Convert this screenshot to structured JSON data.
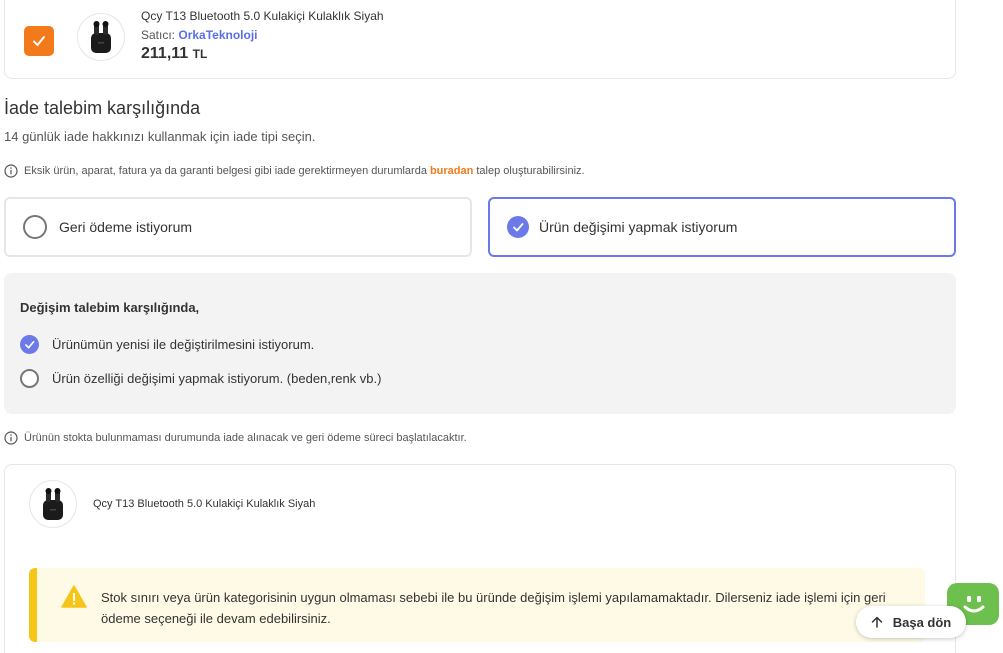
{
  "top_product": {
    "title": "Qcy T13 Bluetooth 5.0 Kulakiçi Kulaklık Siyah",
    "seller_label": "Satıcı:",
    "seller_name": "OrkaTeknoloji",
    "price": "211,11",
    "currency": "TL",
    "selected": true
  },
  "section": {
    "title": "İade talebim karşılığında",
    "subtitle": "14 günlük iade hakkınızı kullanmak için iade tipi seçin."
  },
  "info_note": {
    "before": "Eksik ürün, aparat, fatura ya da garanti belgesi gibi iade gerektirmeyen durumlarda",
    "link": "buradan",
    "after": "talep oluşturabilirsiniz."
  },
  "options": {
    "refund_label": "Geri ödeme istiyorum",
    "exchange_label": "Ürün değişimi yapmak istiyorum",
    "selected": "exchange"
  },
  "exchange_panel": {
    "title": "Değişim talebim karşılığında,",
    "option_new": "Ürünümün yenisi ile değiştirilmesini istiyorum.",
    "option_attr": "Ürün özelliği değişimi yapmak istiyorum. (beden,renk vb.)",
    "selected": "new"
  },
  "stock_note": "Ürünün stokta bulunmaması durumunda iade alınacak ve geri ödeme süreci başlatılacaktır.",
  "bottom_product": {
    "title": "Qcy T13 Bluetooth 5.0 Kulakiçi Kulaklık Siyah"
  },
  "warning": {
    "text": "Stok sınırı veya ürün kategorisinin uygun olmaması sebebi ile bu üründe değişim işlemi yapılamamaktadır. Dilerseniz iade işlemi için geri ödeme seçeneği ile devam edebilirsiniz."
  },
  "back_to_top": "Başa dön",
  "colors": {
    "accent_orange": "#f27a1a",
    "accent_blue": "#6b7ae8",
    "warning_yellow": "#f5c518",
    "chat_green": "#6dc04d"
  }
}
